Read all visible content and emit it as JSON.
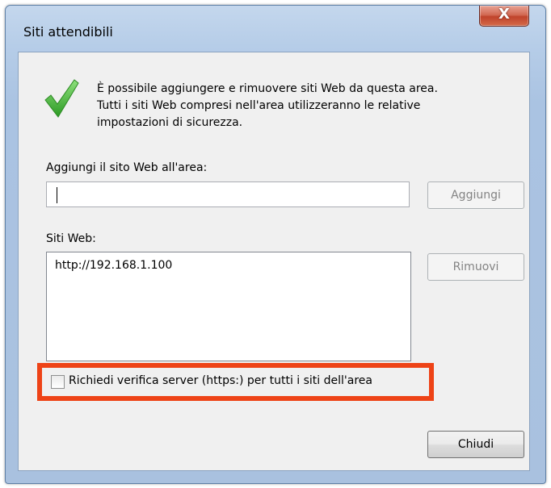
{
  "dialog": {
    "title": "Siti attendibili",
    "close_glyph": "X",
    "info_lines": [
      "È possibile aggiungere e rimuovere siti Web da questa area.",
      "Tutti i siti Web compresi nell'area utilizzeranno le relative",
      "impostazioni di sicurezza."
    ],
    "add_label": "Aggiungi il sito Web all'area:",
    "add_input_value": "",
    "add_button": "Aggiungi",
    "sites_label": "Siti Web:",
    "sites": [
      "http://192.168.1.100"
    ],
    "remove_button": "Rimuovi",
    "https_checkbox_label": "Richiedi verifica server (https:) per tutti i siti dell'area",
    "https_checked": false,
    "close_button": "Chiudi"
  },
  "icons": {
    "info": "checkmark-icon",
    "close": "close-icon"
  },
  "colors": {
    "highlight": "#ee4317",
    "checkmark": "#3aa52e",
    "close_button": "#c94a35"
  }
}
